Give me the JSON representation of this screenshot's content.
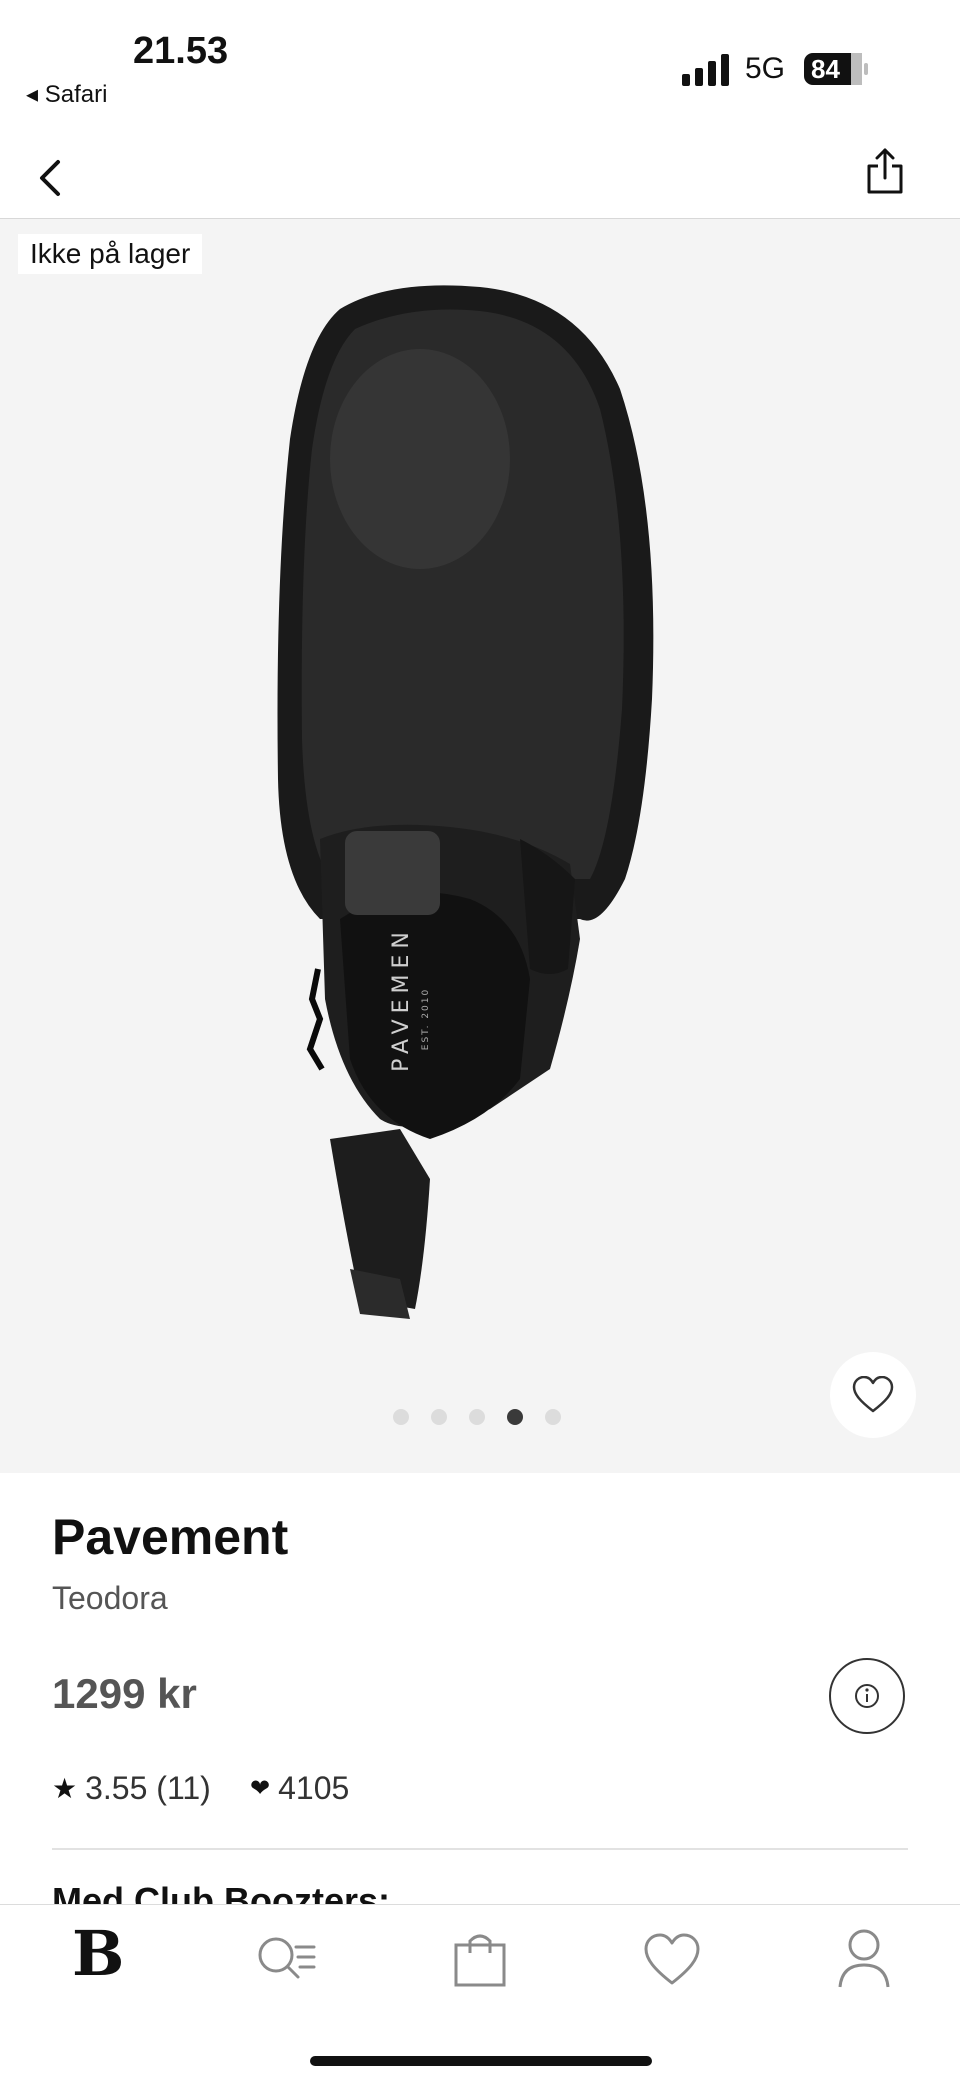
{
  "status_bar": {
    "time": "21.53",
    "back_app": "◂ Safari",
    "network": "5G",
    "battery": "84"
  },
  "nav": {
    "back_icon": "chevron-left-icon",
    "share_icon": "share-icon"
  },
  "gallery": {
    "stock_badge": "Ikke på lager",
    "insole_brand": "PAVEMEN",
    "insole_est": "EST. 2010",
    "image_count": 5,
    "active_index": 3
  },
  "product": {
    "brand": "Pavement",
    "model": "Teodora",
    "price": "1299 kr",
    "rating_star": "★",
    "rating": "3.55 (11)",
    "likes_heart": "❤",
    "likes": "4105",
    "teaser": "Med Club Boozters:"
  },
  "tabbar": {
    "home_logo": "B",
    "items": [
      "home-logo",
      "search-icon",
      "bag-icon",
      "heart-icon",
      "profile-icon"
    ]
  },
  "colors": {
    "gallery_bg": "#f4f4f4",
    "text_primary": "#111111",
    "text_secondary": "#555555"
  }
}
